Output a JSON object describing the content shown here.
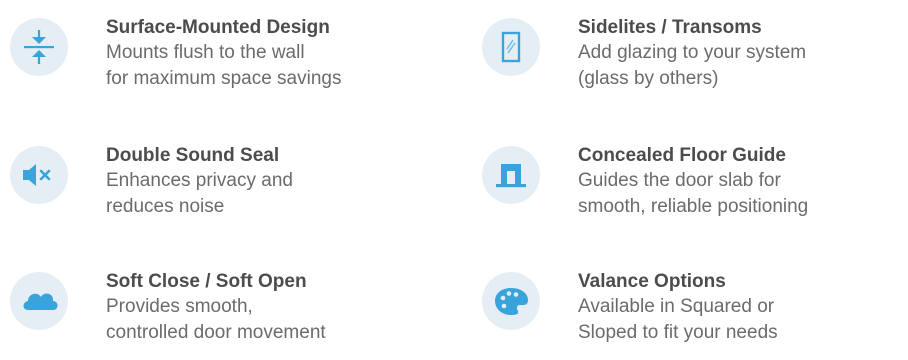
{
  "colors": {
    "icon_blue": "#39a3dc",
    "icon_bg": "#e6eef5",
    "title": "#4c4c4c",
    "desc": "#6b6b6b"
  },
  "features": [
    {
      "icon": "compress-icon",
      "title": "Surface-Mounted Design",
      "desc_line1": "Mounts flush to the wall",
      "desc_line2": "for maximum space savings"
    },
    {
      "icon": "mute-speaker-icon",
      "title": "Double Sound Seal",
      "desc_line1": "Enhances privacy and",
      "desc_line2": "reduces noise"
    },
    {
      "icon": "cloud-icon",
      "title": "Soft Close / Soft Open",
      "desc_line1": "Provides smooth,",
      "desc_line2": "controlled door movement"
    },
    {
      "icon": "window-glass-icon",
      "title": "Sidelites / Transoms",
      "desc_line1": "Add glazing to your system",
      "desc_line2": "(glass by others)"
    },
    {
      "icon": "floor-guide-icon",
      "title": "Concealed Floor Guide",
      "desc_line1": "Guides the door slab for",
      "desc_line2": "smooth, reliable positioning"
    },
    {
      "icon": "palette-icon",
      "title": "Valance Options",
      "desc_line1": "Available in Squared or",
      "desc_line2": "Sloped to fit your needs"
    }
  ]
}
